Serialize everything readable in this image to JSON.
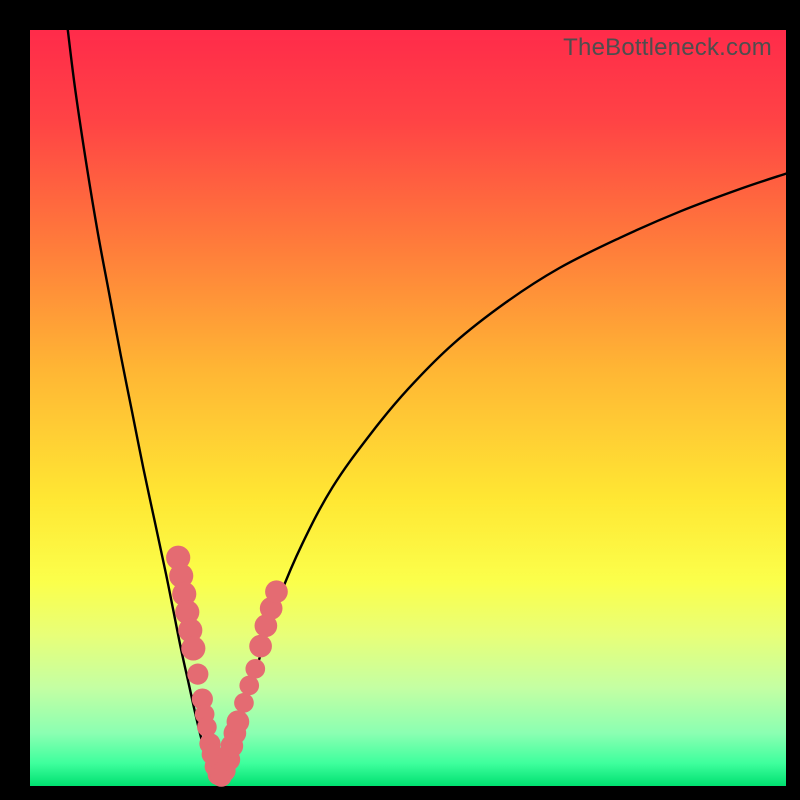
{
  "watermark": "TheBottleneck.com",
  "colors": {
    "frame": "#000000",
    "curve_stroke": "#000000",
    "marker_fill": "#e46b72",
    "gradient_stops": [
      {
        "offset": 0.0,
        "color": "#ff2b4a"
      },
      {
        "offset": 0.12,
        "color": "#ff4345"
      },
      {
        "offset": 0.28,
        "color": "#ff7a3b"
      },
      {
        "offset": 0.45,
        "color": "#ffb634"
      },
      {
        "offset": 0.62,
        "color": "#ffe733"
      },
      {
        "offset": 0.73,
        "color": "#fbff4b"
      },
      {
        "offset": 0.8,
        "color": "#e8ff78"
      },
      {
        "offset": 0.87,
        "color": "#c4ffa3"
      },
      {
        "offset": 0.93,
        "color": "#8bffb2"
      },
      {
        "offset": 0.97,
        "color": "#3eff9d"
      },
      {
        "offset": 1.0,
        "color": "#00e070"
      }
    ]
  },
  "chart_data": {
    "type": "line",
    "title": "",
    "xlabel": "",
    "ylabel": "",
    "xlim": [
      0,
      100
    ],
    "ylim": [
      0,
      100
    ],
    "series": [
      {
        "name": "left-branch",
        "x": [
          5.0,
          6.0,
          7.5,
          9.0,
          10.5,
          12.0,
          13.5,
          15.0,
          16.5,
          18.0,
          19.0,
          20.0,
          21.0,
          22.0,
          23.0,
          24.0
        ],
        "values": [
          100.0,
          92.0,
          82.0,
          73.0,
          65.0,
          57.0,
          49.5,
          42.0,
          35.0,
          28.0,
          23.0,
          18.0,
          13.5,
          9.0,
          5.0,
          2.0
        ]
      },
      {
        "name": "right-branch",
        "x": [
          26.0,
          27.0,
          28.0,
          29.5,
          31.0,
          33.0,
          36.0,
          40.0,
          45.0,
          50.0,
          56.0,
          63.0,
          70.0,
          78.0,
          86.0,
          94.0,
          100.0
        ],
        "values": [
          2.0,
          5.0,
          9.0,
          14.0,
          19.0,
          25.0,
          32.0,
          39.5,
          46.5,
          52.5,
          58.5,
          64.0,
          68.5,
          72.5,
          76.0,
          79.0,
          81.0
        ]
      },
      {
        "name": "valley-floor",
        "x": [
          24.0,
          24.5,
          25.0,
          25.5,
          26.0
        ],
        "values": [
          2.0,
          1.0,
          0.5,
          1.0,
          2.0
        ]
      }
    ],
    "markers": [
      {
        "series": "left-branch",
        "x": 19.6,
        "y": 30.2,
        "r": 1.6
      },
      {
        "series": "left-branch",
        "x": 20.0,
        "y": 27.8,
        "r": 1.6
      },
      {
        "series": "left-branch",
        "x": 20.4,
        "y": 25.4,
        "r": 1.6
      },
      {
        "series": "left-branch",
        "x": 20.8,
        "y": 23.0,
        "r": 1.6
      },
      {
        "series": "left-branch",
        "x": 21.2,
        "y": 20.6,
        "r": 1.6
      },
      {
        "series": "left-branch",
        "x": 21.6,
        "y": 18.2,
        "r": 1.6
      },
      {
        "series": "left-branch",
        "x": 22.2,
        "y": 14.8,
        "r": 1.4
      },
      {
        "series": "left-branch",
        "x": 22.8,
        "y": 11.5,
        "r": 1.4
      },
      {
        "series": "left-branch",
        "x": 23.1,
        "y": 9.5,
        "r": 1.3
      },
      {
        "series": "left-branch",
        "x": 23.4,
        "y": 7.8,
        "r": 1.3
      },
      {
        "series": "left-branch",
        "x": 23.8,
        "y": 5.6,
        "r": 1.4
      },
      {
        "series": "left-branch",
        "x": 24.1,
        "y": 4.2,
        "r": 1.4
      },
      {
        "series": "valley-floor",
        "x": 24.5,
        "y": 2.6,
        "r": 1.4
      },
      {
        "series": "valley-floor",
        "x": 24.9,
        "y": 1.5,
        "r": 1.4
      },
      {
        "series": "valley-floor",
        "x": 25.3,
        "y": 1.3,
        "r": 1.4
      },
      {
        "series": "valley-floor",
        "x": 25.8,
        "y": 2.0,
        "r": 1.4
      },
      {
        "series": "right-branch",
        "x": 26.3,
        "y": 3.5,
        "r": 1.5
      },
      {
        "series": "right-branch",
        "x": 26.7,
        "y": 5.3,
        "r": 1.5
      },
      {
        "series": "right-branch",
        "x": 27.1,
        "y": 7.0,
        "r": 1.5
      },
      {
        "series": "right-branch",
        "x": 27.5,
        "y": 8.5,
        "r": 1.5
      },
      {
        "series": "right-branch",
        "x": 28.3,
        "y": 11.0,
        "r": 1.3
      },
      {
        "series": "right-branch",
        "x": 29.0,
        "y": 13.3,
        "r": 1.3
      },
      {
        "series": "right-branch",
        "x": 29.8,
        "y": 15.5,
        "r": 1.3
      },
      {
        "series": "right-branch",
        "x": 30.5,
        "y": 18.5,
        "r": 1.5
      },
      {
        "series": "right-branch",
        "x": 31.2,
        "y": 21.2,
        "r": 1.5
      },
      {
        "series": "right-branch",
        "x": 31.9,
        "y": 23.5,
        "r": 1.5
      },
      {
        "series": "right-branch",
        "x": 32.6,
        "y": 25.7,
        "r": 1.5
      }
    ]
  }
}
